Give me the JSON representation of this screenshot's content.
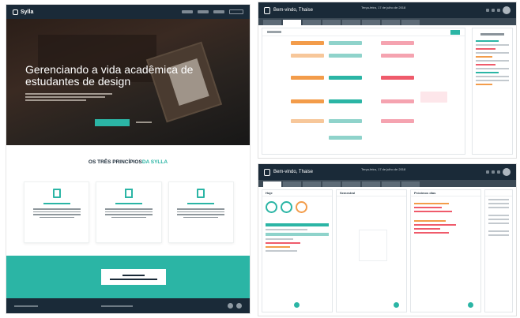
{
  "landing": {
    "brand": "Sylla",
    "hero_title": "Gerenciando a vida acadêmica de estudantes de design",
    "section_title_main": "OS TRÊS PRINCÍPIOS",
    "section_title_suffix": "DA SYLLA"
  },
  "app_top": {
    "brand": "Bem-vindo, Thaise",
    "date_line": "Terça-feira, 17 de julho de 2018"
  },
  "dashboard": {
    "panel1_title": "Hoje",
    "panel2_title": "Semestral",
    "panel3_title": "Próximos dias"
  },
  "colors": {
    "navy": "#1a2a38",
    "teal": "#2bb5a5",
    "orange": "#f39c4a",
    "red": "#ef5b6b"
  }
}
